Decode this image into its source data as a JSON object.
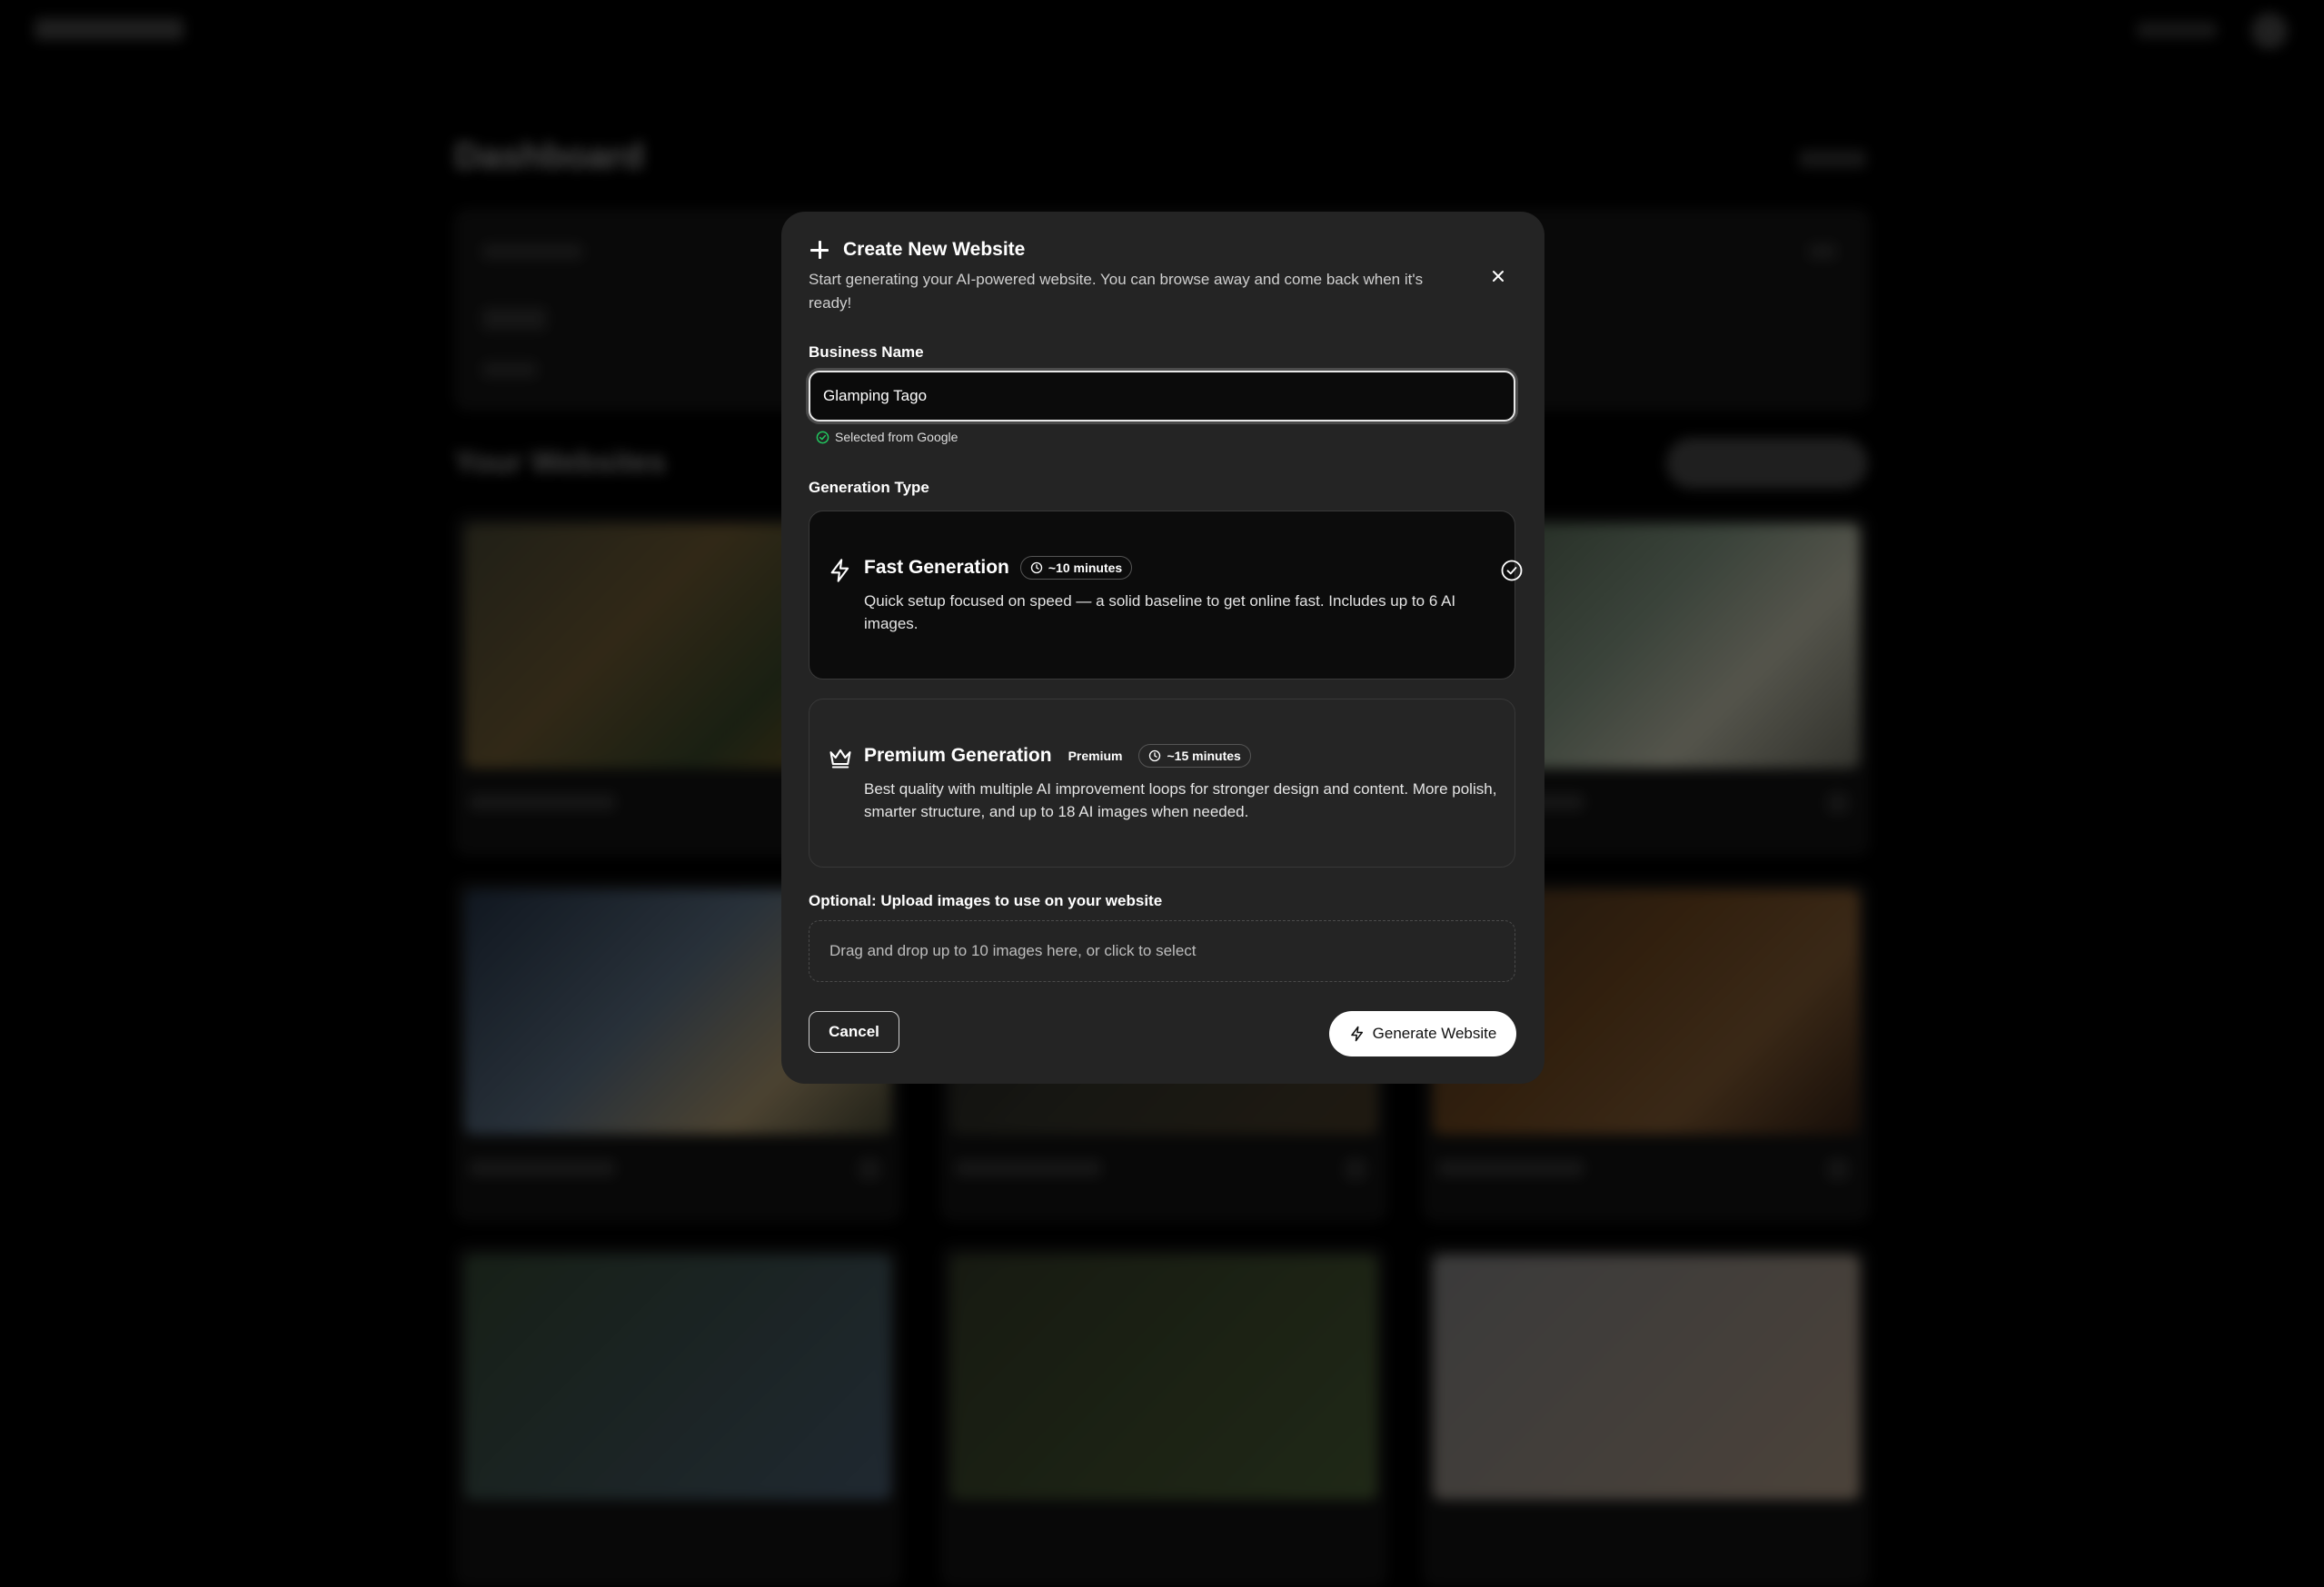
{
  "dashboard": {
    "title": "Dashboard",
    "section_title": "Your Websites"
  },
  "modal": {
    "title": "Create New Website",
    "subtitle": "Start generating your AI-powered website. You can browse away and come back when it's ready!",
    "business_name": {
      "label": "Business Name",
      "value": "Glamping Tago",
      "note": "Selected from Google"
    },
    "generation_type": {
      "label": "Generation Type",
      "options": [
        {
          "title": "Fast Generation",
          "eta": "~10 minutes",
          "description": "Quick setup focused on speed — a solid baseline to get online fast. Includes up to 6 AI images.",
          "icon": "zap-icon",
          "selected": true
        },
        {
          "title": "Premium Generation",
          "badge": "Premium",
          "eta": "~15 minutes",
          "description": "Best quality with multiple AI improvement loops for stronger design and content. More polish, smarter structure, and up to 18 AI images when needed.",
          "icon": "crown-icon",
          "selected": false
        }
      ]
    },
    "upload": {
      "label": "Optional: Upload images to use on your website",
      "placeholder": "Drag and drop up to 10 images here, or click to select"
    },
    "cancel_label": "Cancel",
    "generate_label": "Generate Website"
  },
  "colors": {
    "overlay": "#000000",
    "modal_bg": "#242424",
    "selected_option_bg": "#0c0c0c",
    "primary_button_bg": "#ffffff",
    "success": "#22c55e"
  }
}
